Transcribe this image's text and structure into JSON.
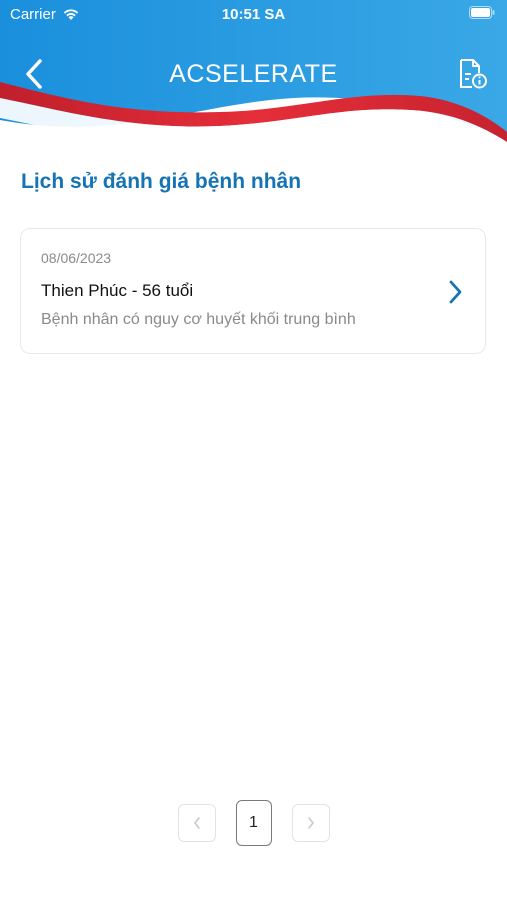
{
  "status_bar": {
    "carrier": "Carrier",
    "time": "10:51 SA"
  },
  "header": {
    "title": "ACSELERATE",
    "back_icon": "chevron-left-icon",
    "info_icon": "document-info-icon"
  },
  "page": {
    "heading": "Lịch sử đánh giá bệnh nhân"
  },
  "records": [
    {
      "date": "08/06/2023",
      "patient": "Thien Phúc - 56 tuổi",
      "status": "Bệnh nhân có nguy cơ huyết khối trung bình"
    }
  ],
  "pagination": {
    "current_page": "1",
    "prev_icon": "chevron-left-icon",
    "next_icon": "chevron-right-icon"
  },
  "colors": {
    "header_blue": "#1f8fd8",
    "wave_red": "#e12b38",
    "accent_blue": "#1673b4"
  }
}
